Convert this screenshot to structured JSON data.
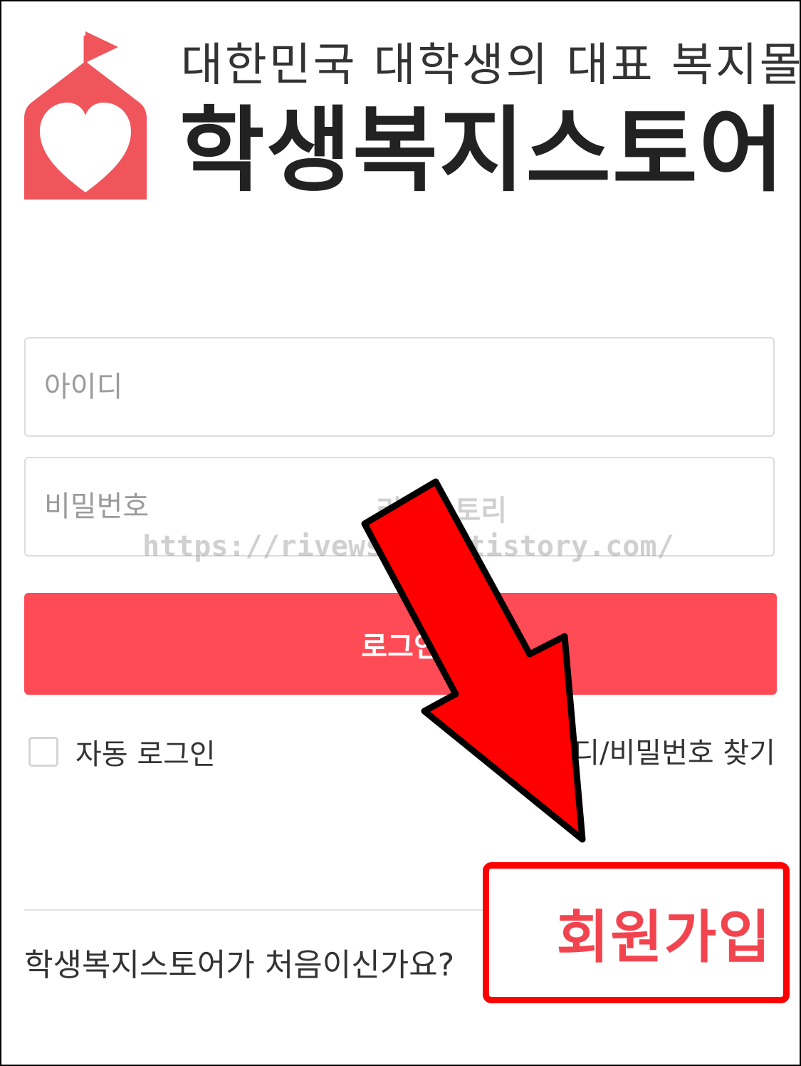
{
  "header": {
    "tagline": "대한민국 대학생의 대표 복지몰",
    "brand_name": "학생복지스토어",
    "logo_icon": "house-heart-flag-logo",
    "brand_color": "#f0555c"
  },
  "login_form": {
    "id_placeholder": "아이디",
    "password_placeholder": "비밀번호",
    "login_button_label": "로그인",
    "login_button_color": "#ff4b56",
    "auto_login_label": "자동 로그인",
    "auto_login_checked": false,
    "find_account_label": "아이디/비밀번호 찾기"
  },
  "footer": {
    "first_time_text": "학생복지스토어가 처음이신가요?",
    "signup_label": "회원가입",
    "signup_color": "#f2444f"
  },
  "annotations": {
    "arrow_icon": "red-down-arrow-icon",
    "highlight_color": "#ff0000",
    "watermark_title": "리뷰스토리",
    "watermark_url": "https://rivewstory.tistory.com/"
  }
}
